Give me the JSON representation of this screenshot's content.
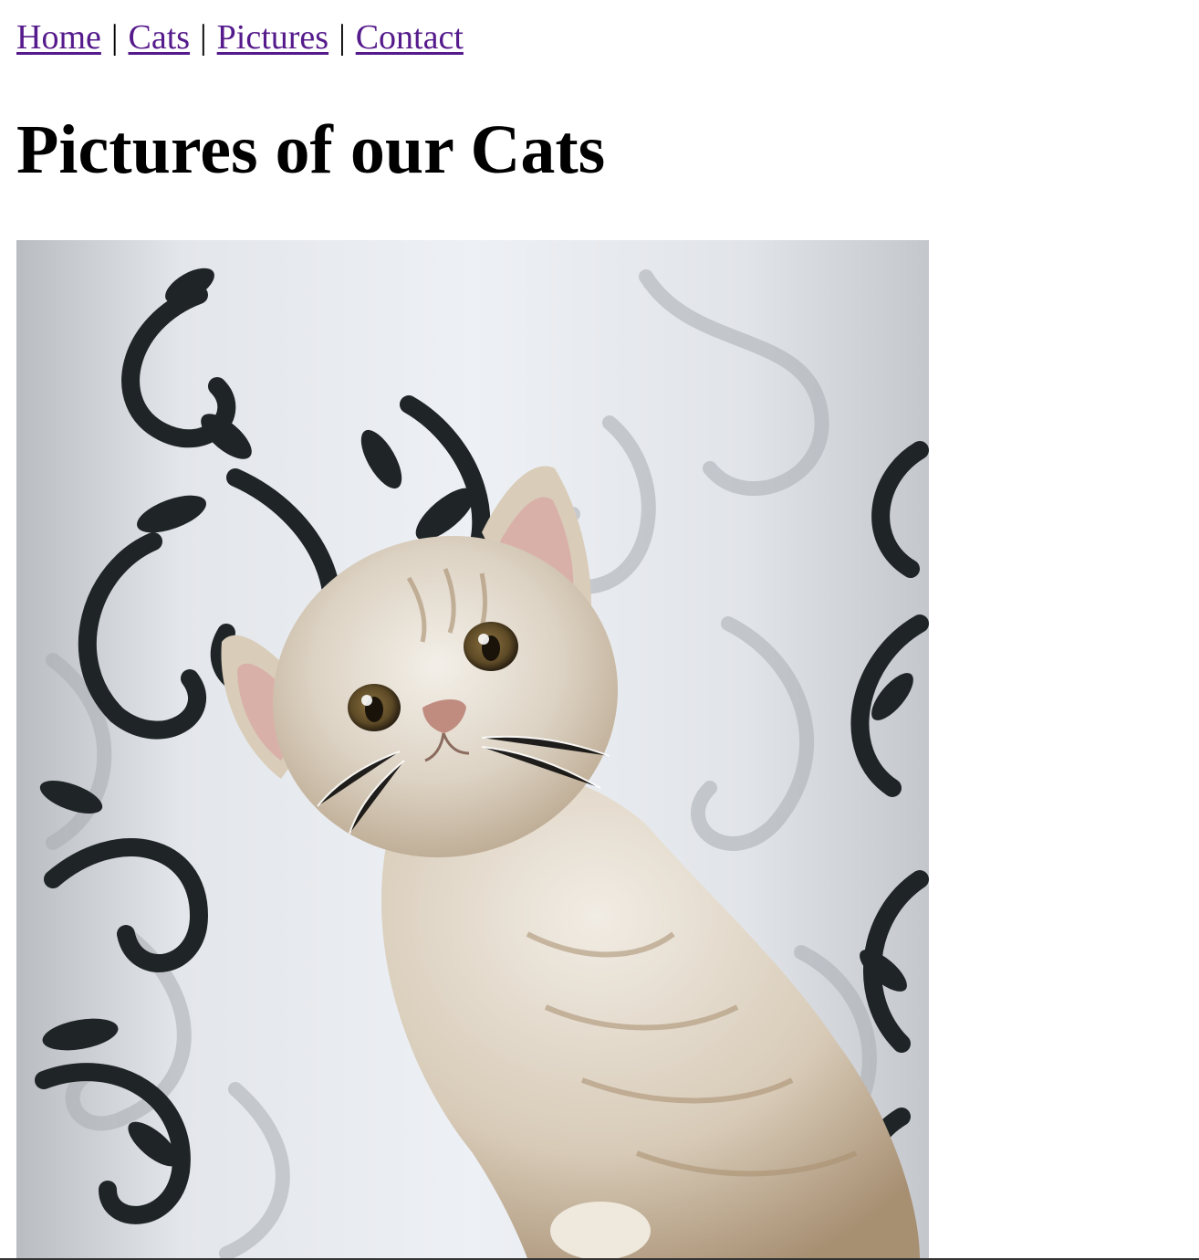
{
  "nav": {
    "links": [
      {
        "label": "Home"
      },
      {
        "label": "Cats"
      },
      {
        "label": "Pictures"
      },
      {
        "label": "Contact"
      }
    ],
    "separator": "|"
  },
  "page": {
    "title": "Pictures of our Cats"
  },
  "photo": {
    "subject": "kitten-photo"
  },
  "colors": {
    "link_visited": "#551a8b",
    "text": "#000000",
    "background": "#ffffff"
  }
}
